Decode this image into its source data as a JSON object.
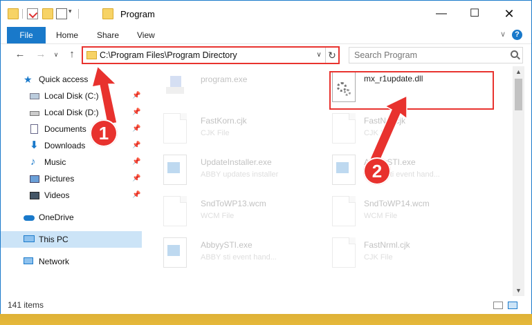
{
  "window": {
    "title": "Program"
  },
  "ribbon": {
    "file": "File",
    "tabs": [
      "Home",
      "Share",
      "View"
    ],
    "help": "?"
  },
  "address": {
    "path": "C:\\Program Files\\Program Directory"
  },
  "search": {
    "placeholder": "Search Program"
  },
  "nav": {
    "quick_access": "Quick access",
    "items": [
      "Local Disk (C:)",
      "Local Disk (D:)",
      "Documents",
      "Downloads",
      "Music",
      "Pictures",
      "Videos"
    ],
    "onedrive": "OneDrive",
    "thispc": "This PC",
    "network": "Network"
  },
  "files": [
    {
      "name": "program.exe",
      "type": ""
    },
    {
      "name": "mx_r1update.dll",
      "type": ""
    },
    {
      "name": "FastKorn.cjk",
      "type": "CJK File"
    },
    {
      "name": "FastNrk.cjk",
      "type": "CJK File"
    },
    {
      "name": "UpdateInstaller.exe",
      "type": "ABBY updates installer"
    },
    {
      "name": "AbbyySTI.exe",
      "type": "ABBY sti event hand..."
    },
    {
      "name": "SndToWP13.wcm",
      "type": "WCM File"
    },
    {
      "name": "SndToWP14.wcm",
      "type": "WCM File"
    },
    {
      "name": "AbbyySTI.exe",
      "type": "ABBY sti event hand..."
    },
    {
      "name": "FastNrml.cjk",
      "type": "CJK File"
    }
  ],
  "status": {
    "count": "141 items"
  },
  "annotations": {
    "step1": "1",
    "step2": "2"
  },
  "colors": {
    "accent": "#1979ca",
    "annotation": "#e8322e"
  }
}
